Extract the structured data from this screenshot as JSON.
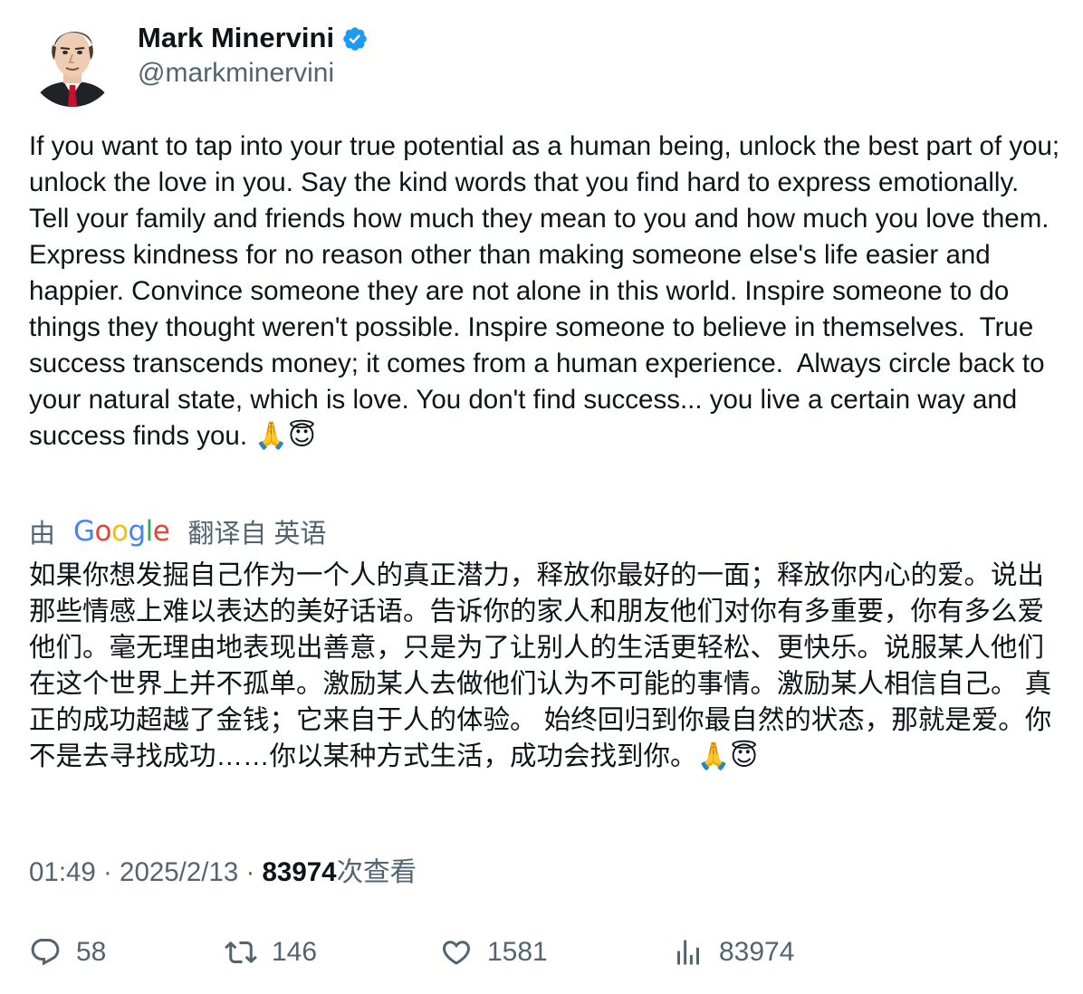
{
  "author": {
    "display_name": "Mark Minervini",
    "handle": "@markminervini",
    "verified": true,
    "verified_color": "#1d9bf0",
    "avatar_icon": "caricature-portrait"
  },
  "tweet": {
    "text": "If you want to tap into your true potential as a human being, unlock the best part of you; unlock the love in you. Say the kind words that you find hard to express emotionally. Tell your family and friends how much they mean to you and how much you love them. Express kindness for no reason other than making someone else's life easier and happier. Convince someone they are not alone in this world. Inspire someone to do things they thought weren't possible. Inspire someone to believe in themselves.  True success transcends money; it comes from a human experience.  Always circle back to your natural state, which is love. You don't find success... you live a certain way and success finds you. 🙏😇"
  },
  "translation": {
    "prefix": "由",
    "provider": "Google",
    "label": "翻译自 英语",
    "text": "如果你想发掘自己作为一个人的真正潜力，释放你最好的一面；释放你内心的爱。说出那些情感上难以表达的美好话语。告诉你的家人和朋友他们对你有多重要，你有多么爱他们。毫无理由地表现出善意，只是为了让别人的生活更轻松、更快乐。说服某人他们在这个世界上并不孤单。激励某人去做他们认为不可能的事情。激励某人相信自己。 真正的成功超越了金钱；它来自于人的体验。 始终回归到你最自然的状态，那就是爱。你不是去寻找成功……你以某种方式生活，成功会找到你。🙏😇"
  },
  "meta": {
    "time": "01:49",
    "separator": " · ",
    "date": "2025/2/13",
    "views_count": "83974",
    "views_label": "次查看"
  },
  "actions": {
    "replies": "58",
    "retweets": "146",
    "likes": "1581",
    "views": "83974"
  },
  "colors": {
    "text": "#0f1419",
    "secondary": "#536471"
  }
}
